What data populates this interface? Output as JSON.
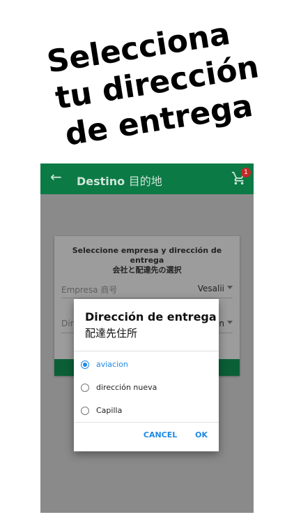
{
  "headline": {
    "line1": "Selecciona",
    "line2": "tu dirección",
    "line3": "de entrega"
  },
  "appbar": {
    "title": "Destino",
    "title_jp": "目的地",
    "cart_badge": "1",
    "color": "#0b7a45"
  },
  "card": {
    "header_es": "Seleccione empresa y dirección de entrega",
    "header_jp": "会社と配達先の選択",
    "company_label": "Empresa 商号",
    "company_value": "Vesalii",
    "address_label_partial": "Dir",
    "address_value_partial": "n"
  },
  "dialog": {
    "title": "Dirección de entrega",
    "title_jp": "配達先住所",
    "options": [
      {
        "label": "aviacion",
        "selected": true
      },
      {
        "label": "dirección nueva",
        "selected": false
      },
      {
        "label": "Capilla",
        "selected": false
      }
    ],
    "cancel_label": "CANCEL",
    "ok_label": "OK",
    "accent": "#1e88e5"
  }
}
